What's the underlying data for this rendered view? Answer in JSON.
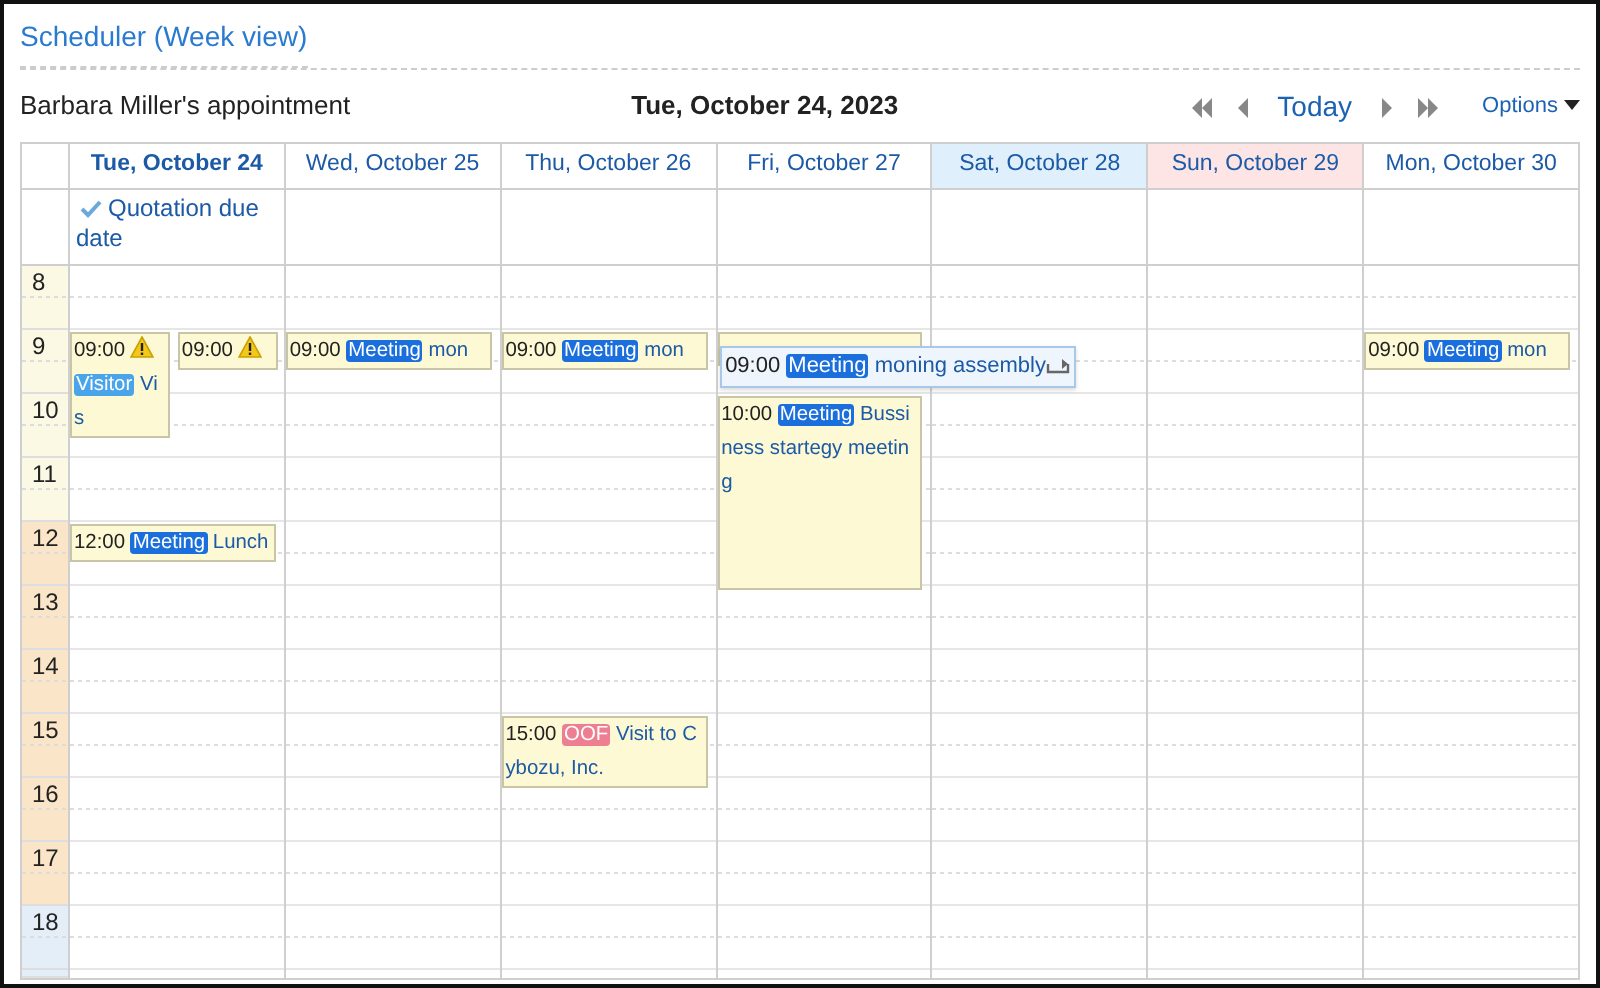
{
  "title": "Scheduler (Week view)",
  "toolbar": {
    "owner": "Barbara Miller's appointment",
    "date": "Tue, October 24, 2023",
    "today": "Today",
    "options": "Options"
  },
  "hours": [
    {
      "label": "8",
      "kind": "morning"
    },
    {
      "label": "9",
      "kind": "morning"
    },
    {
      "label": "10",
      "kind": "morning"
    },
    {
      "label": "11",
      "kind": "morning"
    },
    {
      "label": "12",
      "kind": "afternoon"
    },
    {
      "label": "13",
      "kind": "afternoon"
    },
    {
      "label": "14",
      "kind": "afternoon"
    },
    {
      "label": "15",
      "kind": "afternoon"
    },
    {
      "label": "16",
      "kind": "afternoon"
    },
    {
      "label": "17",
      "kind": "afternoon"
    },
    {
      "label": "18",
      "kind": "evening"
    }
  ],
  "days": [
    {
      "label": "Tue, October 24",
      "kind": "today",
      "all_day": [
        {
          "title": "Quotation due date",
          "done": true
        }
      ],
      "events": [
        {
          "time": "09:00",
          "kind": "line",
          "warning": true,
          "tag": {
            "label": "Visitor",
            "kind": "visitor"
          },
          "title": "Vis"
        },
        {
          "time": "09:00",
          "kind": "line",
          "warning": true
        },
        {
          "time": "12:00",
          "kind": "line",
          "tag": {
            "label": "Meeting",
            "kind": "meeting"
          },
          "title": "Lunch"
        }
      ]
    },
    {
      "label": "Wed, October 25",
      "kind": "weekday",
      "events": [
        {
          "time": "09:00",
          "kind": "line",
          "tag": {
            "label": "Meeting",
            "kind": "meeting"
          },
          "title": "mon"
        }
      ]
    },
    {
      "label": "Thu, October 26",
      "kind": "weekday",
      "events": [
        {
          "time": "09:00",
          "kind": "line",
          "tag": {
            "label": "Meeting",
            "kind": "meeting"
          },
          "title": "mon"
        },
        {
          "time": "15:00",
          "kind": "line",
          "tag": {
            "label": "OOF",
            "kind": "oof"
          },
          "title": "Visit to Cybozu, Inc."
        }
      ]
    },
    {
      "label": "Fri, October 27",
      "kind": "weekday",
      "events": [
        {
          "time": "10:00",
          "kind": "block",
          "tag": {
            "label": "Meeting",
            "kind": "meeting"
          },
          "title": "Bussiness startegy meeting"
        }
      ],
      "popup": {
        "time": "09:00",
        "tag": {
          "label": "Meeting",
          "kind": "meeting"
        },
        "title": "moning assembly",
        "repeat": true,
        "covers_event": true
      }
    },
    {
      "label": "Sat, October 28",
      "kind": "saturday"
    },
    {
      "label": "Sun, October 29",
      "kind": "sunday"
    },
    {
      "label": "Mon, October 30",
      "kind": "weekday",
      "events": [
        {
          "time": "09:00",
          "kind": "line",
          "tag": {
            "label": "Meeting",
            "kind": "meeting"
          },
          "title": "mon"
        }
      ]
    }
  ]
}
